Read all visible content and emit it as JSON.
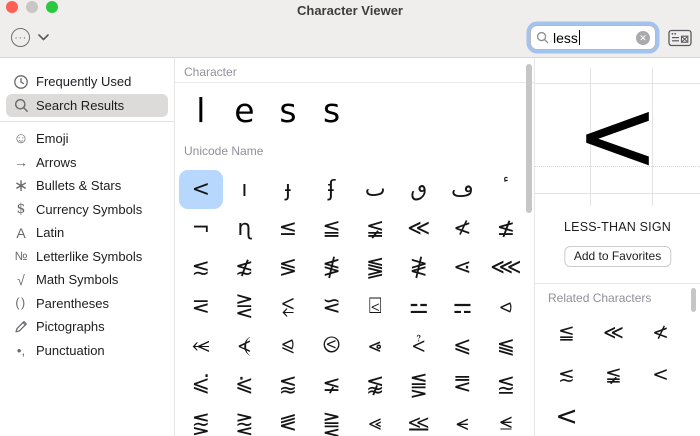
{
  "window": {
    "title": "Character Viewer"
  },
  "toolbar": {
    "actions_button_glyph": "···",
    "search": {
      "value": "less",
      "clear_label": "✕"
    }
  },
  "sidebar": {
    "items": [
      {
        "icon": "clock",
        "label": "Frequently Used",
        "selected": false,
        "divider_after": false
      },
      {
        "icon": "magnifier",
        "label": "Search Results",
        "selected": true,
        "divider_after": true
      },
      {
        "icon": "smiley",
        "label": "Emoji",
        "selected": false,
        "divider_after": false
      },
      {
        "icon": "arrow-right",
        "label": "Arrows",
        "selected": false,
        "divider_after": false
      },
      {
        "icon": "asterisk",
        "label": "Bullets & Stars",
        "selected": false,
        "divider_after": false
      },
      {
        "icon": "dollar",
        "label": "Currency Symbols",
        "selected": false,
        "divider_after": false
      },
      {
        "icon": "letter-a",
        "label": "Latin",
        "selected": false,
        "divider_after": false
      },
      {
        "icon": "numero",
        "label": "Letterlike Symbols",
        "selected": false,
        "divider_after": false
      },
      {
        "icon": "radical",
        "label": "Math Symbols",
        "selected": false,
        "divider_after": false
      },
      {
        "icon": "parentheses",
        "label": "Parentheses",
        "selected": false,
        "divider_after": false
      },
      {
        "icon": "pencil",
        "label": "Pictographs",
        "selected": false,
        "divider_after": false
      },
      {
        "icon": "bullet-comma",
        "label": "Punctuation",
        "selected": false,
        "divider_after": false
      }
    ]
  },
  "main": {
    "section_character": "Character",
    "result_characters": [
      "l",
      "e",
      "s",
      "s"
    ],
    "section_unicode": "Unicode Name",
    "selected_index": 0,
    "glyphs": [
      "<",
      "ı",
      "ɟ",
      "ʄ",
      "ٮ",
      "ٯ",
      "ڡ",
      "ٴ",
      "¬",
      "ɳ",
      "≤",
      "≦",
      "≨",
      "≪",
      "≮",
      "≰",
      "≲",
      "≴",
      "≶",
      "≸",
      "⪓",
      "≹",
      "⋖",
      "⋘",
      "⋜",
      "⋛",
      "⥶",
      "⪝",
      "⍃",
      "⚍",
      "⚎",
      "⪦",
      "⥷",
      "⦓",
      "⪨",
      "⧀",
      "⩹",
      "⩻",
      "⩽",
      "⫹",
      "⪃",
      "⪁",
      "⪅",
      "⪇",
      "⪉",
      "⪋",
      "⪙",
      "⪍",
      "⪏",
      "⪐",
      "⪛",
      "⪌",
      "⪡",
      "⪣",
      "⪪",
      "⪬"
    ]
  },
  "detail": {
    "preview_glyph": "<",
    "character_name": "LESS-THAN SIGN",
    "add_favorites_label": "Add to Favorites",
    "related_header": "Related Characters",
    "related_glyphs": [
      "≦",
      "≪",
      "≮",
      "≲",
      "≨",
      "<",
      "<"
    ]
  },
  "colors": {
    "grid_selection": "#b7d7fc",
    "sidebar_selection": "#dcdbda",
    "focus_ring": "#a3c3ef",
    "traffic_red": "#ff5f57",
    "traffic_gray": "#c9c7c6",
    "traffic_green": "#2bc840"
  }
}
